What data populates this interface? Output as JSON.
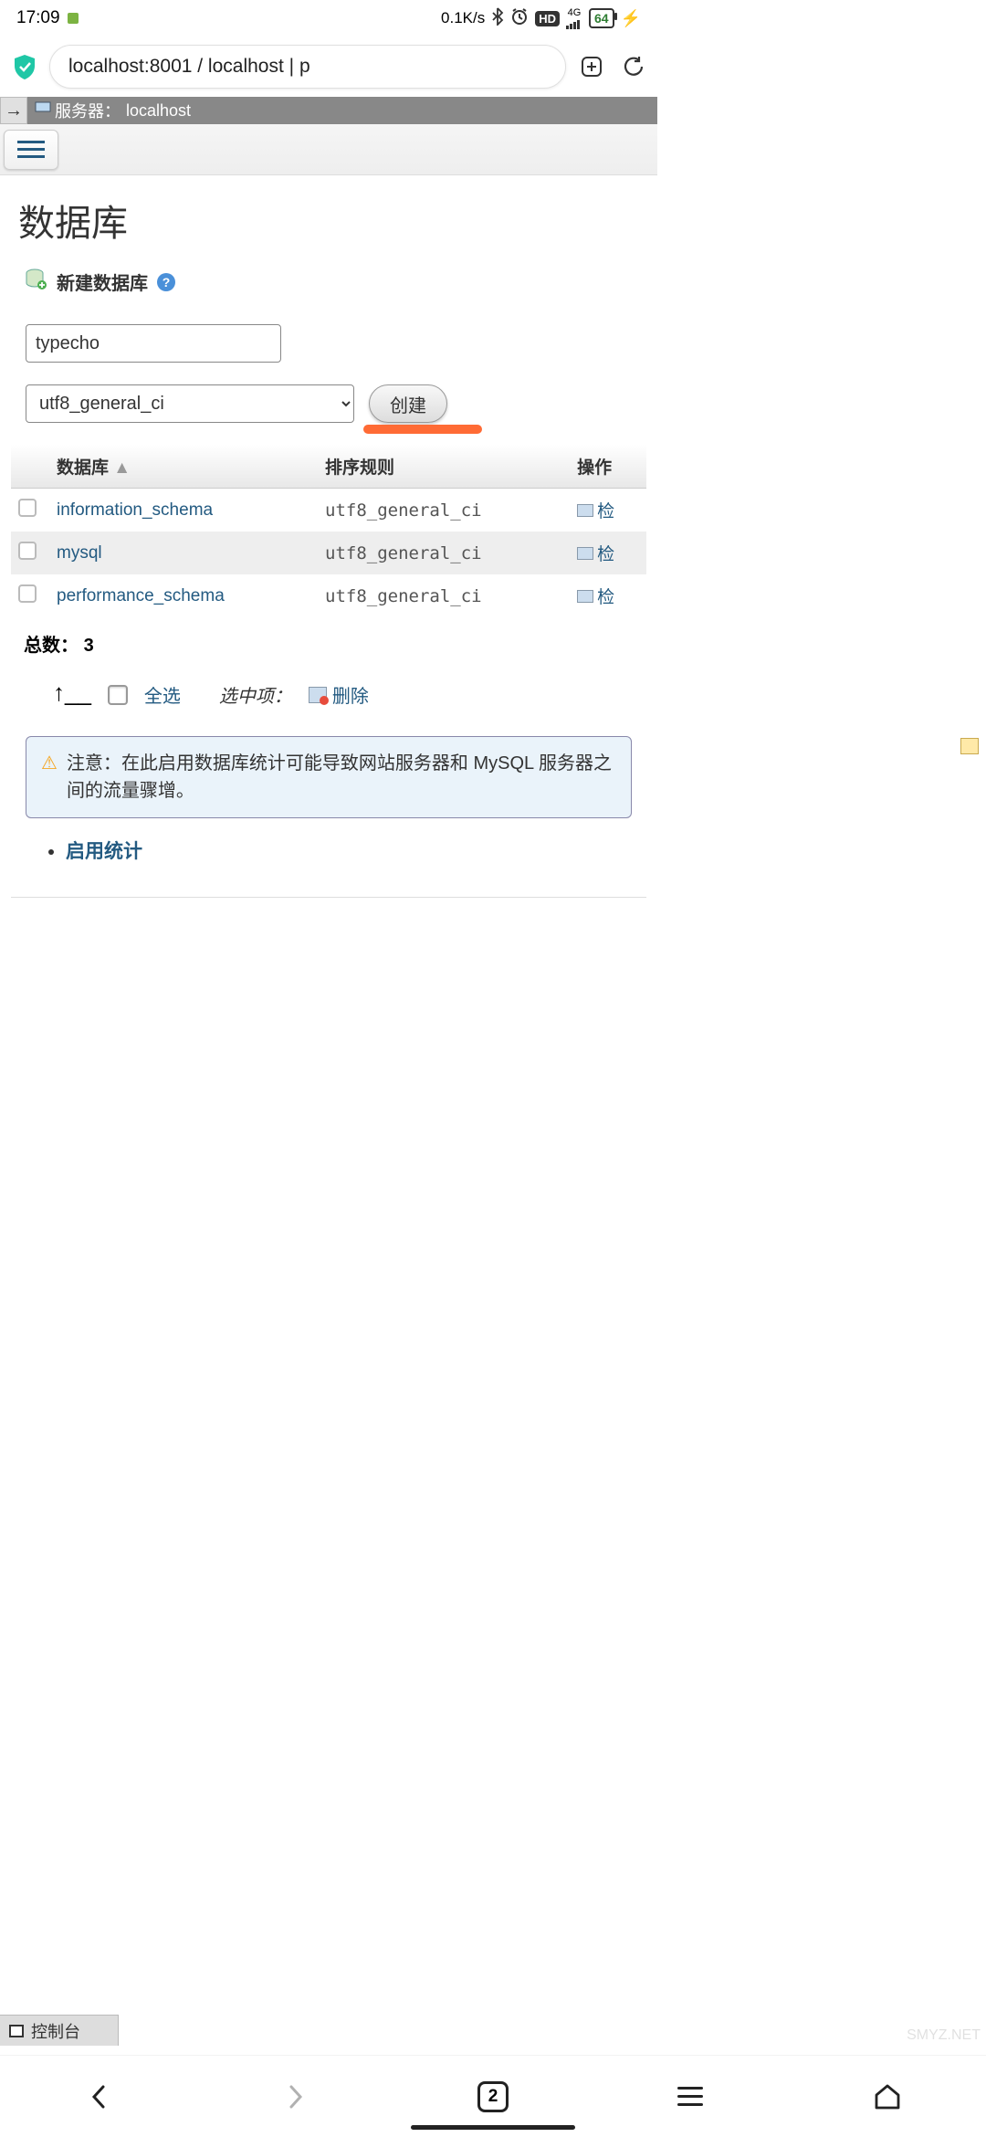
{
  "status": {
    "time": "17:09",
    "net_speed": "0.1K/s",
    "network_label": "4G",
    "battery_pct": "64"
  },
  "browser": {
    "url_display": "localhost:8001 / localhost | p",
    "tab_count": "2"
  },
  "breadcrumb": {
    "server_label": "服务器：",
    "server_name": "localhost"
  },
  "page": {
    "title": "数据库",
    "create_db_label": "新建数据库",
    "db_name_value": "typecho",
    "collation_value": "utf8_general_ci",
    "create_button": "创建"
  },
  "table": {
    "headers": {
      "db": "数据库",
      "collation": "排序规则",
      "action": "操作"
    },
    "rows": [
      {
        "name": "information_schema",
        "collation": "utf8_general_ci",
        "action": "检"
      },
      {
        "name": "mysql",
        "collation": "utf8_general_ci",
        "action": "检"
      },
      {
        "name": "performance_schema",
        "collation": "utf8_general_ci",
        "action": "检"
      }
    ],
    "total_label": "总数：",
    "total_value": "3"
  },
  "bulk": {
    "select_all": "全选",
    "selected_label": "选中项：",
    "delete": "删除"
  },
  "notice": {
    "prefix": "注意：",
    "text": "在此启用数据库统计可能导致网站服务器和 MySQL 服务器之间的流量骤增。"
  },
  "enable_stats": "启用统计",
  "console_label": "控制台",
  "watermark": "SMYZ.NET"
}
